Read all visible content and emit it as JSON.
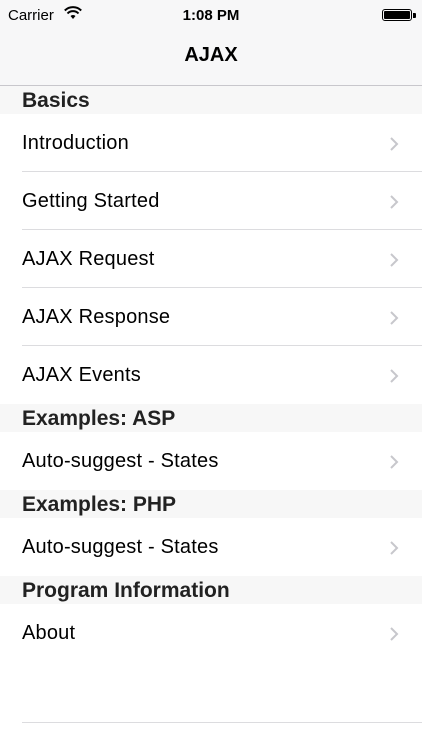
{
  "status_bar": {
    "carrier": "Carrier",
    "time": "1:08 PM",
    "wifi_icon": "wifi-icon",
    "battery_icon": "battery-icon"
  },
  "nav": {
    "title": "AJAX"
  },
  "sections": [
    {
      "header": "Basics",
      "items": [
        "Introduction",
        "Getting Started",
        "AJAX Request",
        "AJAX Response",
        "AJAX Events"
      ]
    },
    {
      "header": "Examples: ASP",
      "items": [
        "Auto-suggest - States"
      ]
    },
    {
      "header": "Examples: PHP",
      "items": [
        "Auto-suggest - States"
      ]
    },
    {
      "header": "Program Information",
      "items": [
        "About"
      ]
    }
  ],
  "colors": {
    "nav_background": "#f7f7f8",
    "section_background": "#f7f7f7",
    "chevron": "#c7c7cc",
    "separator": "#dcdcdf"
  }
}
